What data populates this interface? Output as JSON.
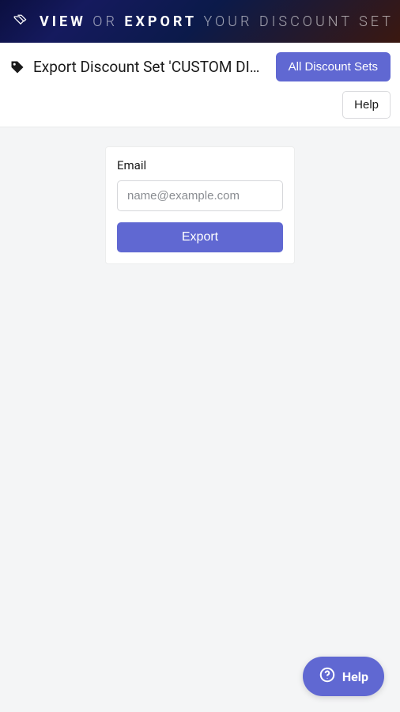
{
  "banner": {
    "word1": "View",
    "or": "or",
    "word2": "Export",
    "tail": "your discount set"
  },
  "header": {
    "title": "Export Discount Set 'CUSTOM DIS...",
    "all_sets_label": "All Discount Sets",
    "help_label": "Help"
  },
  "form": {
    "email_label": "Email",
    "email_placeholder": "name@example.com",
    "email_value": "",
    "submit_label": "Export"
  },
  "widget": {
    "label": "Help"
  }
}
